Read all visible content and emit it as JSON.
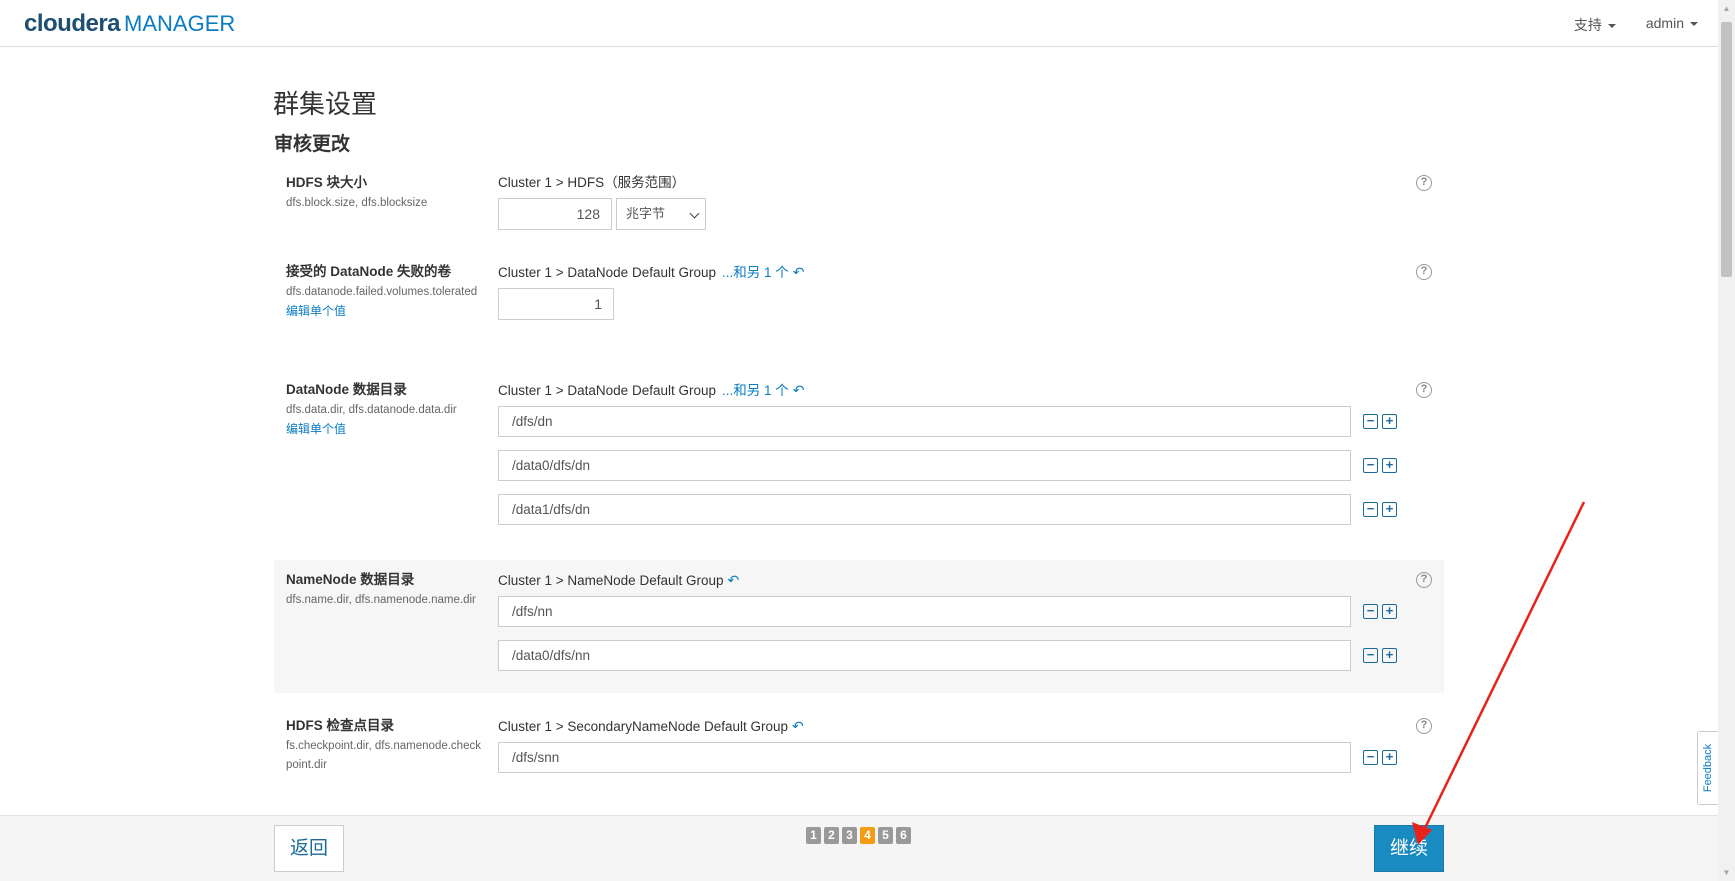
{
  "header": {
    "logo_main": "cloudera",
    "logo_sub": "MANAGER",
    "support_label": "支持",
    "user_label": "admin"
  },
  "page": {
    "title": "群集设置",
    "subtitle": "审核更改"
  },
  "settings": [
    {
      "label": "HDFS 块大小",
      "key": "dfs.block.size, dfs.blocksize",
      "scope": "Cluster 1 > HDFS（服务范围）",
      "value": "128",
      "unit": "兆字节",
      "help": "?"
    },
    {
      "label": "接受的 DataNode 失败的卷",
      "key": "dfs.datanode.failed.volumes.tolerated",
      "edit_link": "编辑单个值",
      "scope": "Cluster 1 > DataNode Default Group",
      "scope_extra": "...和另 1 个",
      "value": "1",
      "help": "?"
    },
    {
      "label": "DataNode 数据目录",
      "key": "dfs.data.dir, dfs.datanode.data.dir",
      "edit_link": "编辑单个值",
      "scope": "Cluster 1 > DataNode Default Group",
      "scope_extra": "...和另 1 个",
      "values": [
        "/dfs/dn",
        "/data0/dfs/dn",
        "/data1/dfs/dn"
      ],
      "help": "?"
    },
    {
      "label": "NameNode 数据目录",
      "key": "dfs.name.dir, dfs.namenode.name.dir",
      "scope": "Cluster 1 > NameNode Default Group",
      "values": [
        "/dfs/nn",
        "/data0/dfs/nn"
      ],
      "help": "?"
    },
    {
      "label": "HDFS 检查点目录",
      "key": "fs.checkpoint.dir, dfs.namenode.checkpoint.dir",
      "scope": "Cluster 1 > SecondaryNameNode Default Group",
      "values": [
        "/dfs/snn"
      ],
      "help": "?"
    }
  ],
  "footer": {
    "back_label": "返回",
    "continue_label": "继续",
    "steps": [
      "1",
      "2",
      "3",
      "4",
      "5",
      "6"
    ],
    "active_step": "4"
  },
  "feedback_label": "Feedback",
  "colors": {
    "brand": "#1e4f73",
    "link": "#0a7cc1",
    "primary_button": "#1a8bc1",
    "active_step": "#f39c12",
    "annotation_arrow": "#e8221b"
  },
  "icons": {
    "undo": "undo-arrow-icon",
    "help": "question-circle-icon",
    "remove": "minus-square-icon",
    "add": "plus-square-icon"
  }
}
